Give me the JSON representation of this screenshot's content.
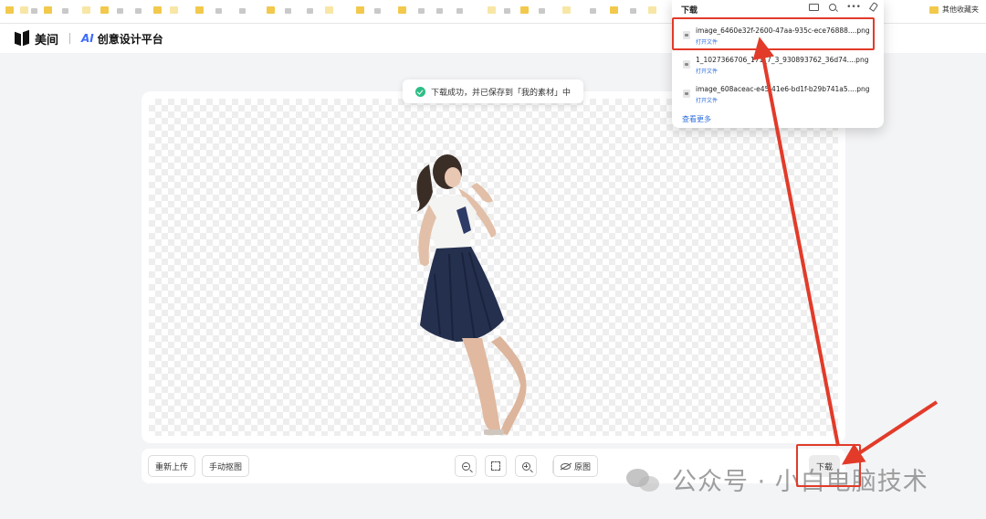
{
  "browser": {
    "other_bookmarks_label": "其他收藏夹"
  },
  "app": {
    "brand": "美间",
    "ai_badge": "AI",
    "product_name": "创意设计平台"
  },
  "toast": {
    "icon": "check-circle-icon",
    "message": "下载成功，并已保存到「我的素材」中"
  },
  "toolbar": {
    "reupload_label": "重新上传",
    "manual_cutout_label": "手动抠图",
    "zoom_out_icon": "zoom-out-icon",
    "fit_icon": "fit-screen-icon",
    "zoom_in_icon": "zoom-in-icon",
    "original_label": "原图",
    "download_label": "下载"
  },
  "downloads": {
    "title": "下载",
    "items": [
      {
        "filename": "image_6460e32f-2600-47aa-935c-ece76888....png",
        "action": "打开文件"
      },
      {
        "filename": "1_1027366706_171_7_3_930893762_36d74....png",
        "action": "打开文件"
      },
      {
        "filename": "image_608aceac-e45-41e6-bd1f-b29b741a5....png",
        "action": "打开文件"
      }
    ],
    "see_more": "查看更多"
  },
  "watermark": {
    "text": "公众号 · 小白电脑技术"
  },
  "colors": {
    "annotation_red": "#e23b2a",
    "link_blue": "#2f6fde",
    "success_green": "#2ebd85",
    "ai_blue": "#3d6cff"
  }
}
